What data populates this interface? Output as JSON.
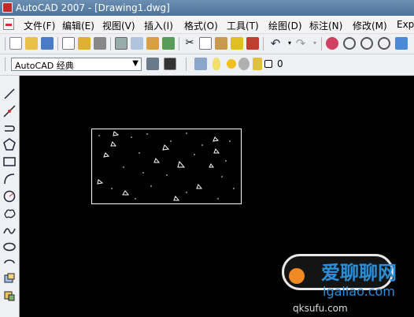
{
  "window": {
    "title": "AutoCAD 2007 - [Drawing1.dwg]"
  },
  "menu": {
    "items": [
      "文件(F)",
      "编辑(E)",
      "视图(V)",
      "插入(I)",
      "格式(O)",
      "工具(T)",
      "绘图(D)",
      "标注(N)",
      "修改(M)",
      "Exp"
    ]
  },
  "workspace": {
    "value": "AutoCAD 经典"
  },
  "layer": {
    "value": "0"
  },
  "watermark": {
    "main": "爱聊聊网",
    "sub": "igaliao.com",
    "bottom": "qksufu.com"
  },
  "colors": {
    "canvas": "#000000",
    "accent": "#2a8ed8"
  }
}
